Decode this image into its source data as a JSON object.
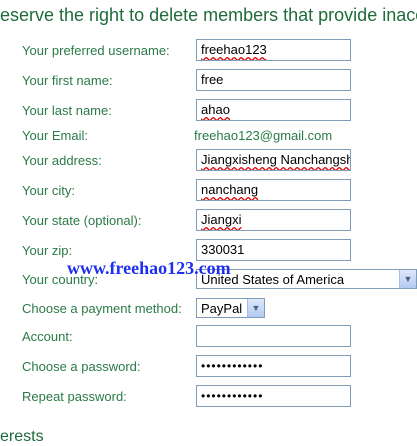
{
  "notice": "eserve the right to delete members that provide inacc",
  "fields": {
    "username": {
      "label": "Your preferred username:",
      "value": "freehao123"
    },
    "first_name": {
      "label": "Your first name:",
      "value": "free"
    },
    "last_name": {
      "label": "Your last name:",
      "value": "ahao"
    },
    "email": {
      "label": "Your Email:",
      "value": "freehao123@gmail.com"
    },
    "address": {
      "label": "Your address:",
      "value": "Jiangxisheng Nanchangsh"
    },
    "city": {
      "label": "Your city:",
      "value": "nanchang"
    },
    "state": {
      "label": "Your state (optional):",
      "value": "Jiangxi"
    },
    "zip": {
      "label": "Your zip:",
      "value": "330031"
    },
    "country": {
      "label": "Your country:",
      "value": "United States of America"
    },
    "payment": {
      "label": "Choose a payment method:",
      "value": "PayPal"
    },
    "account": {
      "label": "Account:",
      "value": ""
    },
    "password": {
      "label": "Choose a password:",
      "value": "••••••••••••"
    },
    "repeat_password": {
      "label": "Repeat password:",
      "value": "••••••••••••"
    }
  },
  "watermark": "www.freehao123.com",
  "section_heading": "erests",
  "icons": {
    "dropdown": "chevron-down-icon"
  },
  "colors": {
    "label_green": "#2a7a47",
    "heading_green": "#1f6b3a",
    "watermark_blue": "#1d2ff0",
    "input_border": "#7f9db9"
  }
}
